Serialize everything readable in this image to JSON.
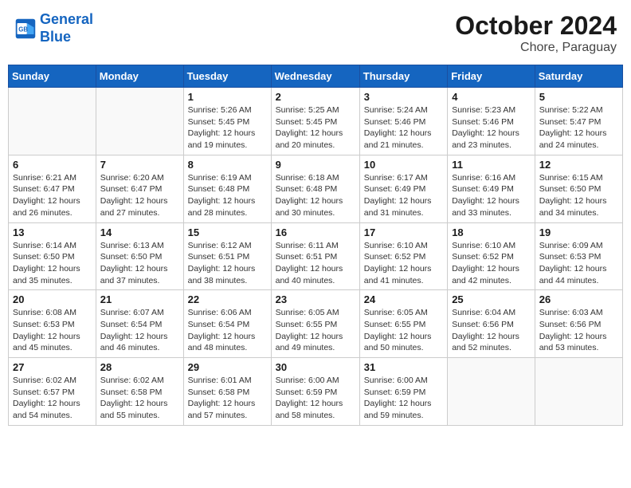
{
  "header": {
    "logo_line1": "General",
    "logo_line2": "Blue",
    "title": "October 2024",
    "location": "Chore, Paraguay"
  },
  "weekdays": [
    "Sunday",
    "Monday",
    "Tuesday",
    "Wednesday",
    "Thursday",
    "Friday",
    "Saturday"
  ],
  "weeks": [
    [
      {
        "day": "",
        "info": ""
      },
      {
        "day": "",
        "info": ""
      },
      {
        "day": "1",
        "info": "Sunrise: 5:26 AM\nSunset: 5:45 PM\nDaylight: 12 hours and 19 minutes."
      },
      {
        "day": "2",
        "info": "Sunrise: 5:25 AM\nSunset: 5:45 PM\nDaylight: 12 hours and 20 minutes."
      },
      {
        "day": "3",
        "info": "Sunrise: 5:24 AM\nSunset: 5:46 PM\nDaylight: 12 hours and 21 minutes."
      },
      {
        "day": "4",
        "info": "Sunrise: 5:23 AM\nSunset: 5:46 PM\nDaylight: 12 hours and 23 minutes."
      },
      {
        "day": "5",
        "info": "Sunrise: 5:22 AM\nSunset: 5:47 PM\nDaylight: 12 hours and 24 minutes."
      }
    ],
    [
      {
        "day": "6",
        "info": "Sunrise: 6:21 AM\nSunset: 6:47 PM\nDaylight: 12 hours and 26 minutes."
      },
      {
        "day": "7",
        "info": "Sunrise: 6:20 AM\nSunset: 6:47 PM\nDaylight: 12 hours and 27 minutes."
      },
      {
        "day": "8",
        "info": "Sunrise: 6:19 AM\nSunset: 6:48 PM\nDaylight: 12 hours and 28 minutes."
      },
      {
        "day": "9",
        "info": "Sunrise: 6:18 AM\nSunset: 6:48 PM\nDaylight: 12 hours and 30 minutes."
      },
      {
        "day": "10",
        "info": "Sunrise: 6:17 AM\nSunset: 6:49 PM\nDaylight: 12 hours and 31 minutes."
      },
      {
        "day": "11",
        "info": "Sunrise: 6:16 AM\nSunset: 6:49 PM\nDaylight: 12 hours and 33 minutes."
      },
      {
        "day": "12",
        "info": "Sunrise: 6:15 AM\nSunset: 6:50 PM\nDaylight: 12 hours and 34 minutes."
      }
    ],
    [
      {
        "day": "13",
        "info": "Sunrise: 6:14 AM\nSunset: 6:50 PM\nDaylight: 12 hours and 35 minutes."
      },
      {
        "day": "14",
        "info": "Sunrise: 6:13 AM\nSunset: 6:50 PM\nDaylight: 12 hours and 37 minutes."
      },
      {
        "day": "15",
        "info": "Sunrise: 6:12 AM\nSunset: 6:51 PM\nDaylight: 12 hours and 38 minutes."
      },
      {
        "day": "16",
        "info": "Sunrise: 6:11 AM\nSunset: 6:51 PM\nDaylight: 12 hours and 40 minutes."
      },
      {
        "day": "17",
        "info": "Sunrise: 6:10 AM\nSunset: 6:52 PM\nDaylight: 12 hours and 41 minutes."
      },
      {
        "day": "18",
        "info": "Sunrise: 6:10 AM\nSunset: 6:52 PM\nDaylight: 12 hours and 42 minutes."
      },
      {
        "day": "19",
        "info": "Sunrise: 6:09 AM\nSunset: 6:53 PM\nDaylight: 12 hours and 44 minutes."
      }
    ],
    [
      {
        "day": "20",
        "info": "Sunrise: 6:08 AM\nSunset: 6:53 PM\nDaylight: 12 hours and 45 minutes."
      },
      {
        "day": "21",
        "info": "Sunrise: 6:07 AM\nSunset: 6:54 PM\nDaylight: 12 hours and 46 minutes."
      },
      {
        "day": "22",
        "info": "Sunrise: 6:06 AM\nSunset: 6:54 PM\nDaylight: 12 hours and 48 minutes."
      },
      {
        "day": "23",
        "info": "Sunrise: 6:05 AM\nSunset: 6:55 PM\nDaylight: 12 hours and 49 minutes."
      },
      {
        "day": "24",
        "info": "Sunrise: 6:05 AM\nSunset: 6:55 PM\nDaylight: 12 hours and 50 minutes."
      },
      {
        "day": "25",
        "info": "Sunrise: 6:04 AM\nSunset: 6:56 PM\nDaylight: 12 hours and 52 minutes."
      },
      {
        "day": "26",
        "info": "Sunrise: 6:03 AM\nSunset: 6:56 PM\nDaylight: 12 hours and 53 minutes."
      }
    ],
    [
      {
        "day": "27",
        "info": "Sunrise: 6:02 AM\nSunset: 6:57 PM\nDaylight: 12 hours and 54 minutes."
      },
      {
        "day": "28",
        "info": "Sunrise: 6:02 AM\nSunset: 6:58 PM\nDaylight: 12 hours and 55 minutes."
      },
      {
        "day": "29",
        "info": "Sunrise: 6:01 AM\nSunset: 6:58 PM\nDaylight: 12 hours and 57 minutes."
      },
      {
        "day": "30",
        "info": "Sunrise: 6:00 AM\nSunset: 6:59 PM\nDaylight: 12 hours and 58 minutes."
      },
      {
        "day": "31",
        "info": "Sunrise: 6:00 AM\nSunset: 6:59 PM\nDaylight: 12 hours and 59 minutes."
      },
      {
        "day": "",
        "info": ""
      },
      {
        "day": "",
        "info": ""
      }
    ]
  ]
}
